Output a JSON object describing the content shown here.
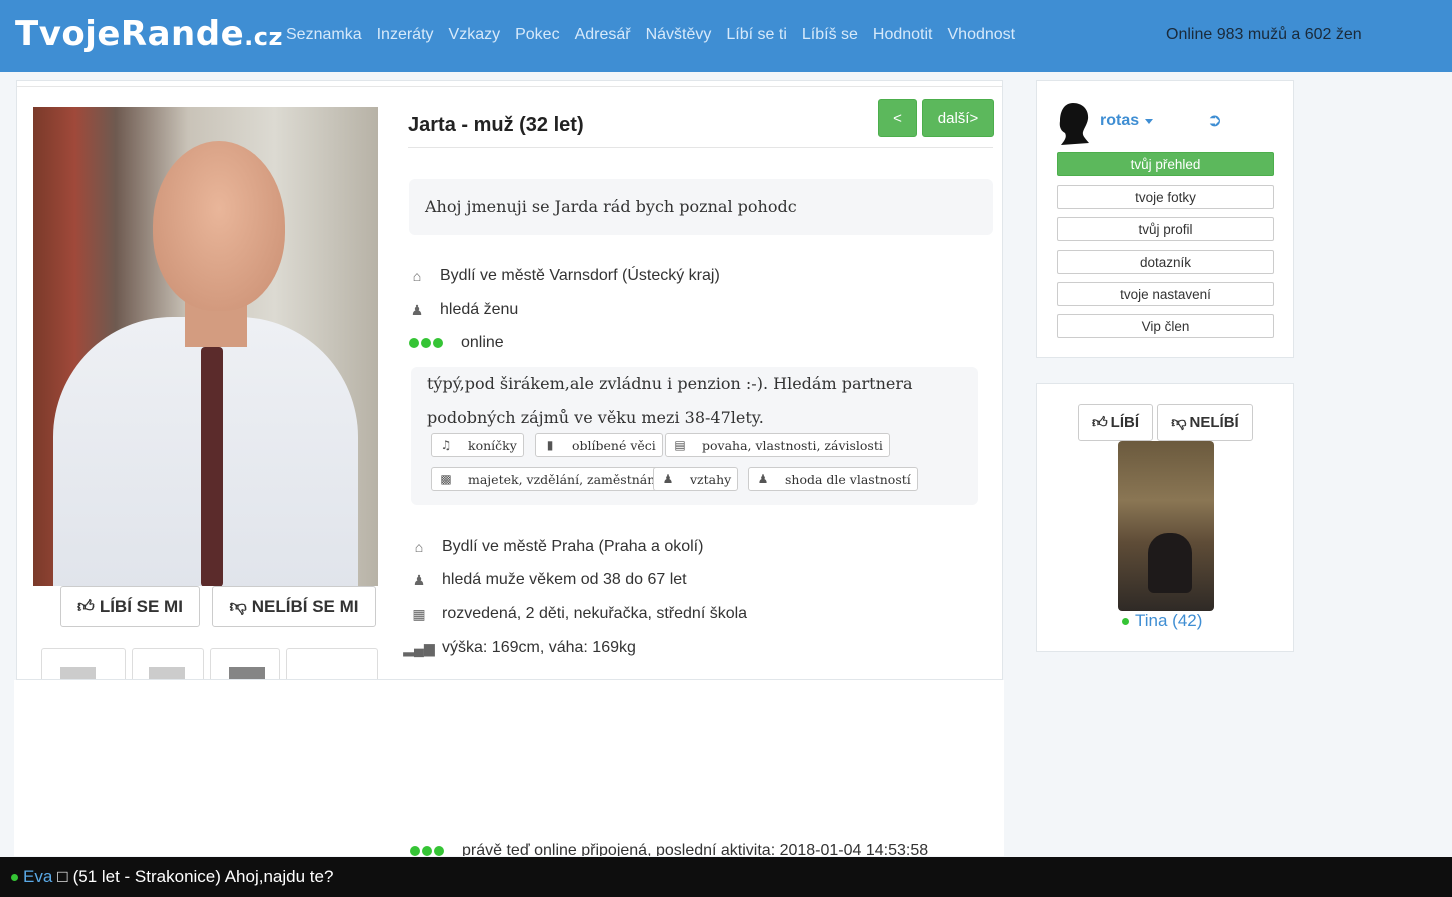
{
  "header": {
    "logo_main": "TvojeRande",
    "logo_tld": ".cz",
    "nav": [
      "Seznamka",
      "Inzeráty",
      "Vzkazy",
      "Pokec",
      "Adresář",
      "Návštěvy",
      "Líbí se ti",
      "Líbíš se",
      "Hodnotit",
      "Vhodnost"
    ],
    "online_text": "Online 983 mužů a 602 žen"
  },
  "profile": {
    "title": "Jarta - muž (32 let)",
    "prev_label": "<",
    "next_label": "další>",
    "intro": "Ahoj jmenuji se Jarda rád bych poznal pohodc",
    "like_label": "LÍBÍ SE MI",
    "dislike_label": "NELÍBÍ SE MI",
    "info_top": {
      "city": "Bydlí ve městě Varnsdorf (Ústecký kraj)",
      "seeking": "hledá ženu",
      "status": "online"
    },
    "about": {
      "line1": "týpý,pod širákem,ale zvládnu i penzion :-). Hledám partnera",
      "line2": "podobných zájmů ve věku mezi 38-47lety."
    },
    "tags": [
      "koníčky",
      "oblíbené věci",
      "povaha, vlastnosti, závislosti",
      "majetek, vzdělání, zaměstnání",
      "vztahy",
      "shoda dle vlastností"
    ],
    "info_bottom": {
      "city": "Bydlí ve městě Praha (Praha a okolí)",
      "seeking": "hledá muže věkem od 38 do 67 let",
      "details": "rozvedená, 2 děti, nekuřačka, střední škola",
      "body": "výška: 169cm, váha: 169kg",
      "activity": "právě teď online připojená, poslední aktivita: 2018-01-04 14:53:58"
    }
  },
  "user_panel": {
    "username": "rotas",
    "menu": [
      "tvůj přehled",
      "tvoje fotky",
      "tvůj profil",
      "dotazník",
      "tvoje nastavení",
      "Vip člen"
    ]
  },
  "suggestion": {
    "like_label": "LÍBÍ",
    "dislike_label": "NELÍBÍ",
    "name": "Tina (42)"
  },
  "bottom_bar": {
    "name": "Eva",
    "glyph": "□",
    "text": "(51 let - Strakonice) Ahoj,najdu te?"
  }
}
